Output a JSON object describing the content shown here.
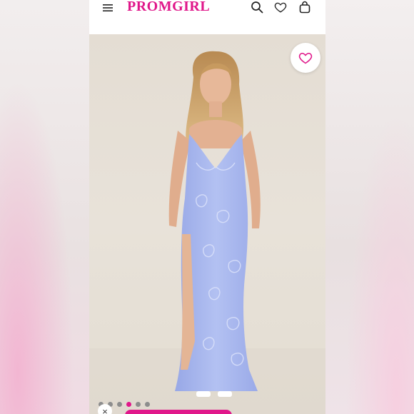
{
  "app": {
    "brand": "PROMGIRL",
    "brand_color": "#e0178a"
  },
  "header": {
    "icons": [
      "menu-icon",
      "search-icon",
      "heart-icon",
      "shopping-bag-icon"
    ]
  },
  "product": {
    "image_icon": "product-photo",
    "favorite_icon": "heart-outline-icon",
    "gallery": {
      "count": 6,
      "active_index": 3
    }
  },
  "footer": {
    "close_glyph": "×"
  },
  "colors": {
    "accent": "#e0178a",
    "dress": "#a9b8ee",
    "backdrop": "#e6dfd5"
  }
}
